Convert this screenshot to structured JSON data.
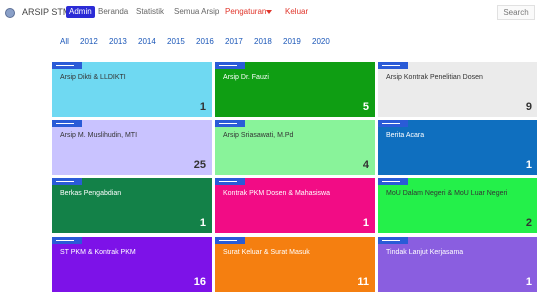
{
  "navbar": {
    "brand": "ARSIP STMIK",
    "admin_badge": "Admin",
    "links": [
      "Beranda",
      "Statistik",
      "Semua Arsip",
      "Pengaturan",
      "Keluar"
    ],
    "search_label": "Search"
  },
  "years": [
    "All",
    "2012",
    "2013",
    "2014",
    "2015",
    "2016",
    "2017",
    "2018",
    "2019",
    "2020"
  ],
  "cards": [
    {
      "title": "Arsip Dikti & LLDIKTI",
      "count": "1",
      "color": "#6fd9f2",
      "text": "#333333"
    },
    {
      "title": "Arsip Dr. Fauzi",
      "count": "5",
      "color": "#0f9e13",
      "text": "#ffffff"
    },
    {
      "title": "Arsip Kontrak Penelitian Dosen",
      "count": "9",
      "color": "#ebebeb",
      "text": "#333333"
    },
    {
      "title": "Arsip M. Muslihudin, MTI",
      "count": "25",
      "color": "#c9c3ff",
      "text": "#333333"
    },
    {
      "title": "Arsip Sriasawati, M.Pd",
      "count": "4",
      "color": "#89f39a",
      "text": "#333333"
    },
    {
      "title": "Berita Acara",
      "count": "1",
      "color": "#0f6fbf",
      "text": "#ffffff"
    },
    {
      "title": "Berkas Pengabdian",
      "count": "1",
      "color": "#138148",
      "text": "#ffffff"
    },
    {
      "title": "Kontrak PKM Dosen & Mahasiswa",
      "count": "1",
      "color": "#f20c85",
      "text": "#ffffff"
    },
    {
      "title": "MoU Dalam Negeri & MoU Luar Negeri",
      "count": "2",
      "color": "#24f04a",
      "text": "#333333"
    },
    {
      "title": "ST PKM & Kontrak PKM",
      "count": "16",
      "color": "#7d12e8",
      "text": "#ffffff"
    },
    {
      "title": "Surat Keluar & Surat Masuk",
      "count": "11",
      "color": "#f57f10",
      "text": "#ffffff"
    },
    {
      "title": "Tindak Lanjut Kerjasama",
      "count": "1",
      "color": "#8a5ee0",
      "text": "#ffffff"
    }
  ]
}
